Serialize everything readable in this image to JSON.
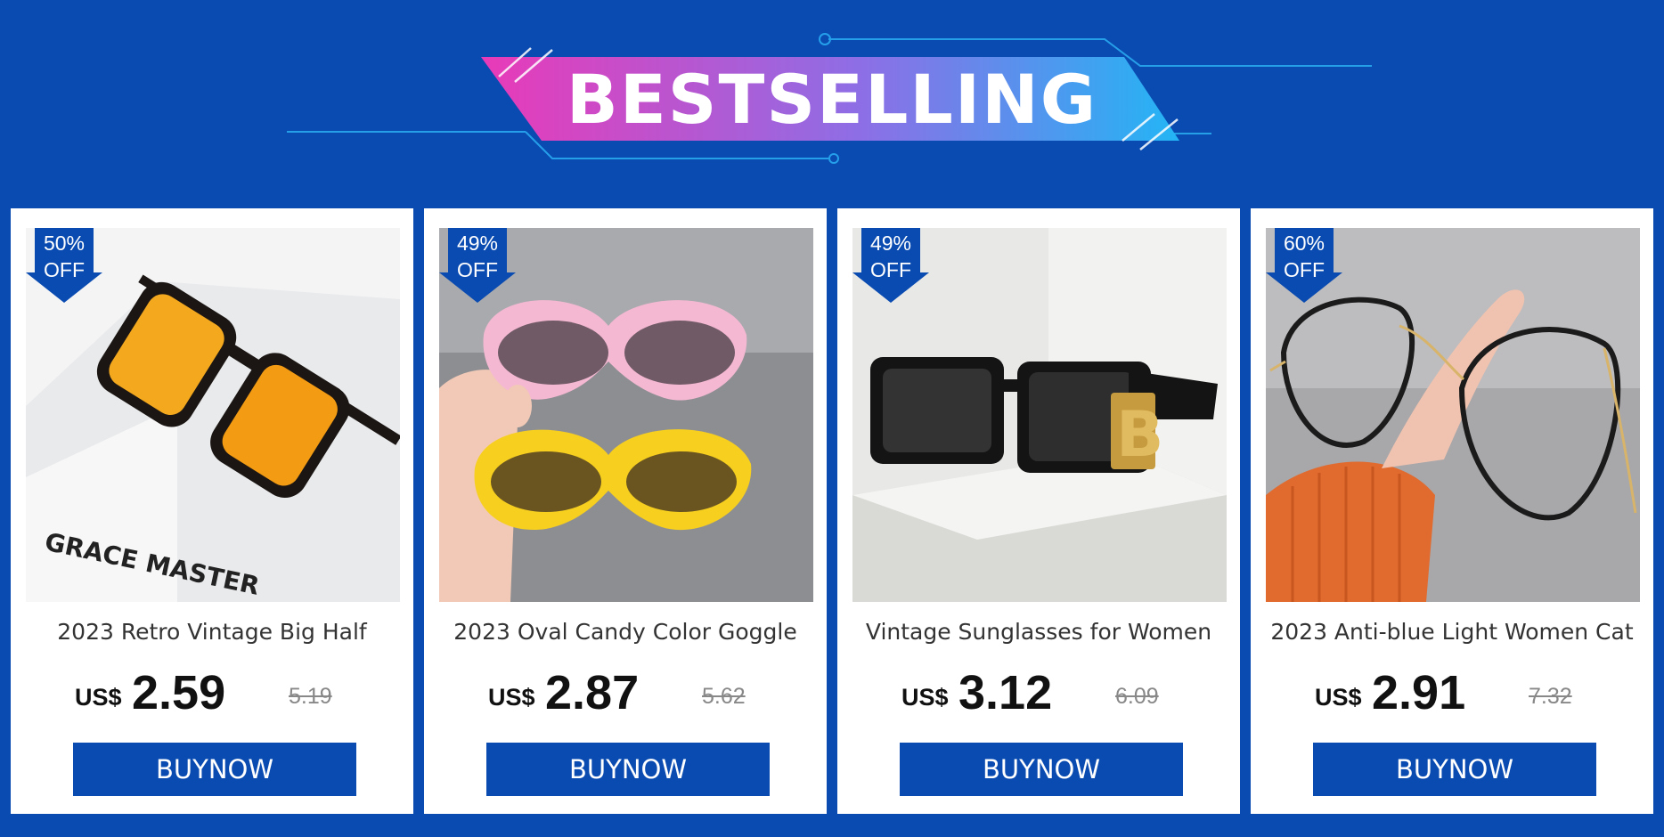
{
  "header": {
    "title": "BESTSELLING"
  },
  "colors": {
    "background": "#0a4bb1",
    "button": "#0a4bb1",
    "banner_gradient_start": "#e93ab8",
    "banner_gradient_end": "#23b5f5"
  },
  "products": [
    {
      "discount": "50%",
      "discount_suffix": "OFF",
      "title": "2023 Retro Vintage Big Half",
      "currency": "US$",
      "price": "2.59",
      "old_price": "5.19",
      "button": "BUYNOW",
      "image_text": "GRACE MASTER"
    },
    {
      "discount": "49%",
      "discount_suffix": "OFF",
      "title": "2023 Oval Candy Color Goggle",
      "currency": "US$",
      "price": "2.87",
      "old_price": "5.62",
      "button": "BUYNOW"
    },
    {
      "discount": "49%",
      "discount_suffix": "OFF",
      "title": "Vintage Sunglasses for Women",
      "currency": "US$",
      "price": "3.12",
      "old_price": "6.09",
      "button": "BUYNOW",
      "image_text": "B"
    },
    {
      "discount": "60%",
      "discount_suffix": "OFF",
      "title": "2023 Anti-blue Light Women Cat",
      "currency": "US$",
      "price": "2.91",
      "old_price": "7.32",
      "button": "BUYNOW"
    }
  ]
}
